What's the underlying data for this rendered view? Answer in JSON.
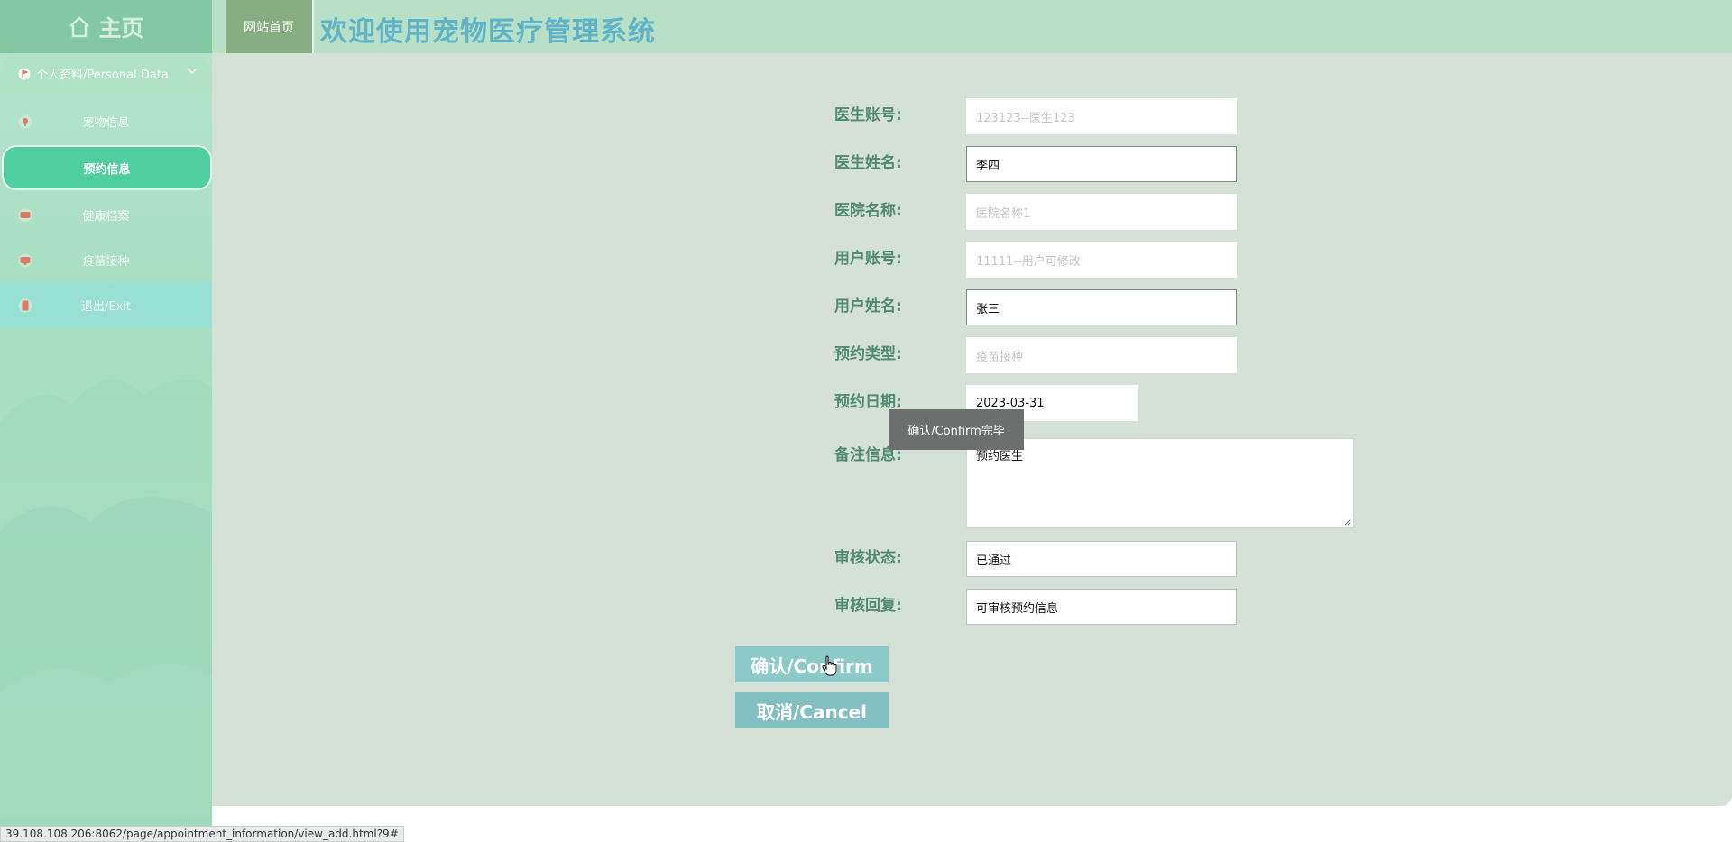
{
  "topbar": {
    "home_label": "主页",
    "site_home": "网站首页",
    "system_title": "欢迎使用宠物医疗管理系统"
  },
  "sidebar": {
    "header": "个人资料/Personal Data",
    "items": [
      {
        "label": "宠物信息",
        "icon": "pin-icon",
        "active": false
      },
      {
        "label": "预约信息",
        "icon": "",
        "active": true
      },
      {
        "label": "健康档案",
        "icon": "chat-icon",
        "active": false
      },
      {
        "label": "疫苗接种",
        "icon": "chat-icon",
        "active": false
      },
      {
        "label": "退出/Exit",
        "icon": "door-icon",
        "active": false
      }
    ]
  },
  "form": {
    "doctor_account": {
      "label": "医生账号:",
      "placeholder": "123123--医生123",
      "value": ""
    },
    "doctor_name": {
      "label": "医生姓名:",
      "placeholder": "",
      "value": "李四"
    },
    "hospital_name": {
      "label": "医院名称:",
      "placeholder": "医院名称1",
      "value": ""
    },
    "user_account": {
      "label": "用户账号:",
      "placeholder": "11111--用户可修改",
      "value": ""
    },
    "user_name": {
      "label": "用户姓名:",
      "placeholder": "",
      "value": "张三"
    },
    "appointment_type": {
      "label": "预约类型:",
      "placeholder": "疫苗接种",
      "value": ""
    },
    "appointment_date": {
      "label": "预约日期:",
      "value": "2023-03-31"
    },
    "remarks": {
      "label": "备注信息:",
      "value": "预约医生"
    },
    "review_status": {
      "label": "审核状态:",
      "value": "已通过"
    },
    "review_reply": {
      "label": "审核回复:",
      "value": "可审核预约信息"
    }
  },
  "tooltip": "确认/Confirm完毕",
  "buttons": {
    "confirm": "确认/Confirm",
    "cancel": "取消/Cancel"
  },
  "status_url": "39.108.108.206:8062/page/appointment_information/view_add.html?9#",
  "colors": {
    "topbar": "#b8e0c7",
    "title": "#5fb3c6",
    "content_bg": "#d5e0d7",
    "label": "#4f8b6c",
    "active_item": "#4fcfa1",
    "button": "#82bfc0"
  }
}
